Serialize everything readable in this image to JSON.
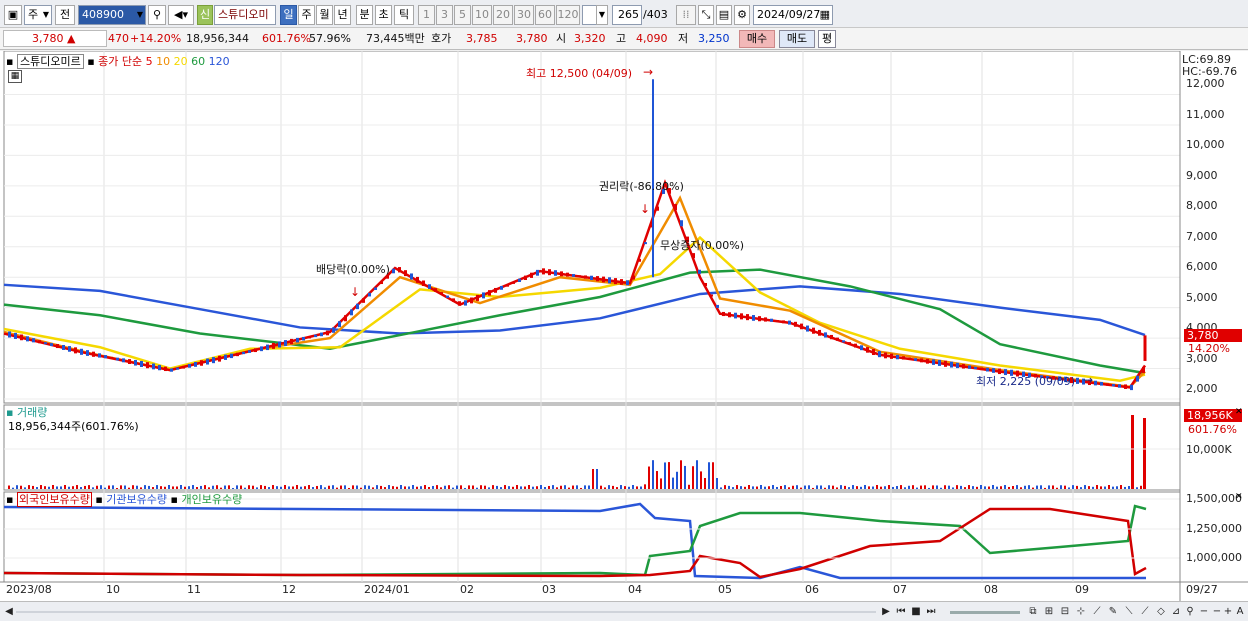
{
  "toolbar": {
    "market": "주",
    "prev_label": "전",
    "code": "408900",
    "new_badge": "신",
    "stock_name": "스튜디오미",
    "periods": [
      "일",
      "주",
      "월",
      "년",
      "분",
      "초",
      "틱"
    ],
    "active_period": "일",
    "intervals": [
      "1",
      "3",
      "5",
      "10",
      "20",
      "30",
      "60",
      "120"
    ],
    "count": "265",
    "total": "/403",
    "date": "2024/09/27"
  },
  "quote": {
    "price": "3,780 ▲",
    "change": "470",
    "change_pct": "+14.20%",
    "volume": "18,956,344",
    "volume_pct": "601.76%",
    "rotation": "57.96%",
    "amount": "73,445백만",
    "bid_label": "호가",
    "bid1": "3,785",
    "bid2": "3,780",
    "open_label": "시",
    "open": "3,320",
    "high_label": "고",
    "high": "4,090",
    "low_label": "저",
    "low": "3,250",
    "buy_label": "매수",
    "sell_label": "매도",
    "eval_label": "평"
  },
  "price_panel": {
    "title": "스튜디오미르",
    "legend_prefix": "종가 단순",
    "ma_legend": [
      {
        "label": "5",
        "color": "#e00000"
      },
      {
        "label": "10",
        "color": "#f08c00"
      },
      {
        "label": "20",
        "color": "#f5d800"
      },
      {
        "label": "60",
        "color": "#1e9a3e"
      },
      {
        "label": "120",
        "color": "#2a56d8"
      }
    ],
    "lc": "LC:69.89",
    "hc": "HC:-69.76",
    "y_ticks": [
      "12,000",
      "11,000",
      "10,000",
      "9,000",
      "8,000",
      "7,000",
      "6,000",
      "5,000",
      "4,000",
      "3,000",
      "2,000"
    ],
    "last_price_tag": "3,780",
    "last_pct_tag": "14.20%",
    "annotations": {
      "high": "최고 12,500 (04/09)",
      "low": "최저 2,225 (09/09)",
      "rights": "권리락(-86.80%)",
      "bonus": "무상증자(0.00%)",
      "dividend": "배당락(0.00%)"
    }
  },
  "volume_panel": {
    "title": "거래량",
    "value": "18,956,344주(601.76%)",
    "tag1": "18,956K",
    "tag2": "601.76%",
    "y_tick": "10,000K"
  },
  "holding_panel": {
    "legends": [
      {
        "label": "외국인보유수량",
        "color": "#d00000"
      },
      {
        "label": "기관보유수량",
        "color": "#2a56d8"
      },
      {
        "label": "개인보유수량",
        "color": "#1e9a3e"
      }
    ],
    "y_ticks": [
      "1,500,000",
      "1,250,000",
      "1,000,000"
    ]
  },
  "x_axis": [
    "2023/08",
    "10",
    "11",
    "12",
    "2024/01",
    "02",
    "03",
    "04",
    "05",
    "06",
    "07",
    "08",
    "09",
    "09/27"
  ],
  "colors": {
    "up": "#e00000",
    "down": "#1f55d6",
    "accent": "#3d6fbf"
  }
}
